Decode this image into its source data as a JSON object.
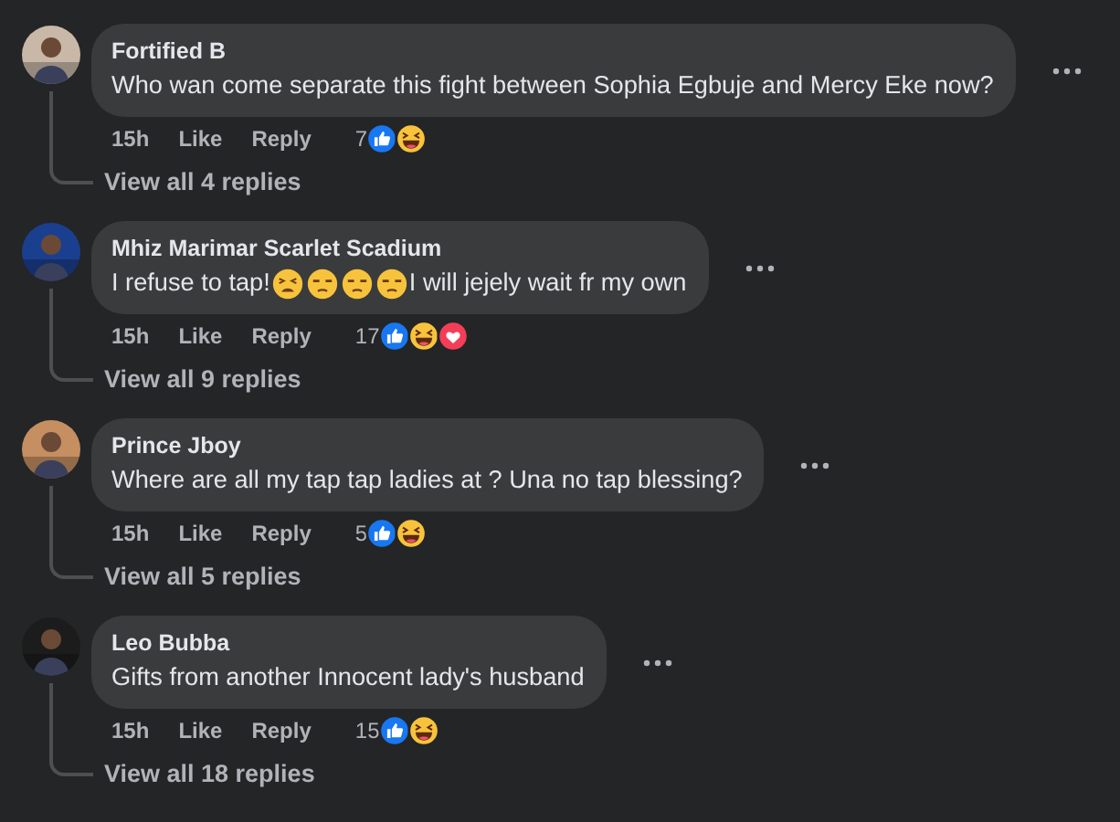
{
  "comments": [
    {
      "author": "Fortified B",
      "segments": [
        {
          "kind": "text",
          "text": "Who wan come separate this fight between Sophia Egbuje and Mercy Eke now?"
        }
      ],
      "time": "15h",
      "like_label": "Like",
      "reply_label": "Reply",
      "reaction_count": "7",
      "reactions": [
        {
          "kind": "like"
        },
        {
          "kind": "haha"
        }
      ],
      "view_replies": "View all 4 replies"
    },
    {
      "author": "Mhiz Marimar Scarlet Scadium",
      "segments": [
        {
          "kind": "text",
          "text": "I refuse to tap!"
        },
        {
          "kind": "tired"
        },
        {
          "kind": "unamused"
        },
        {
          "kind": "unamused"
        },
        {
          "kind": "unamused"
        },
        {
          "kind": "text",
          "text": "I will jejely wait fr my own"
        }
      ],
      "time": "15h",
      "like_label": "Like",
      "reply_label": "Reply",
      "reaction_count": "17",
      "reactions": [
        {
          "kind": "like"
        },
        {
          "kind": "haha"
        },
        {
          "kind": "love"
        }
      ],
      "view_replies": "View all 9 replies"
    },
    {
      "author": "Prince Jboy",
      "segments": [
        {
          "kind": "text",
          "text": "Where are all my tap tap ladies at ? Una no tap blessing?"
        }
      ],
      "time": "15h",
      "like_label": "Like",
      "reply_label": "Reply",
      "reaction_count": "5",
      "reactions": [
        {
          "kind": "like"
        },
        {
          "kind": "haha"
        }
      ],
      "view_replies": "View all 5 replies"
    },
    {
      "author": "Leo Bubba",
      "segments": [
        {
          "kind": "text",
          "text": "Gifts from another Innocent lady's husband"
        }
      ],
      "time": "15h",
      "like_label": "Like",
      "reply_label": "Reply",
      "reaction_count": "15",
      "reactions": [
        {
          "kind": "like"
        },
        {
          "kind": "haha"
        }
      ],
      "view_replies": "View all 18 replies"
    }
  ]
}
